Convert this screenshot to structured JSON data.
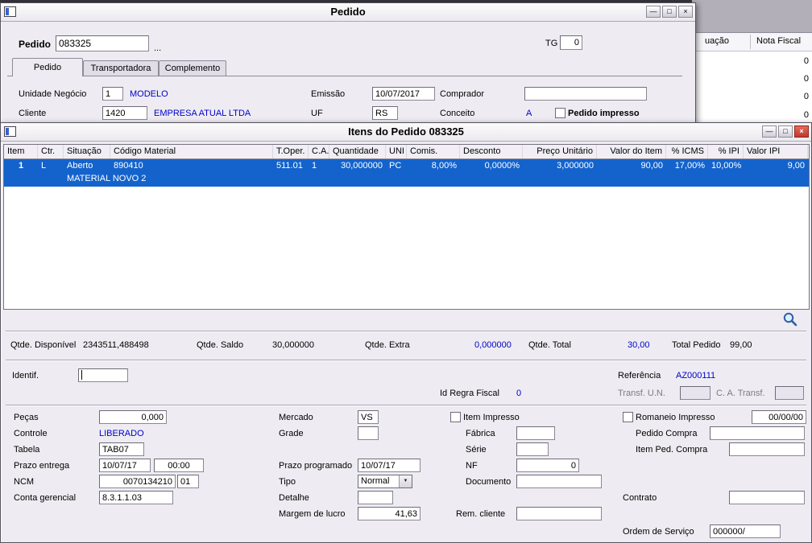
{
  "icons": {
    "minimize": "—",
    "maximize": "□",
    "close": "×",
    "dropdown": "▼",
    "ellipsis": "..."
  },
  "pedido_window": {
    "title": "Pedido",
    "pedido_label": "Pedido",
    "pedido_value": "083325",
    "tg_label": "TG",
    "tg_value": "0",
    "tabs": [
      {
        "label": "Pedido"
      },
      {
        "label": "Transportadora"
      },
      {
        "label": "Complemento"
      }
    ],
    "form": {
      "unidade_negocio_label": "Unidade Negócio",
      "unidade_negocio_value": "1",
      "unidade_negocio_desc": "MODELO",
      "emissao_label": "Emissão",
      "emissao_value": "10/07/2017",
      "comprador_label": "Comprador",
      "comprador_value": "",
      "cliente_label": "Cliente",
      "cliente_value": "1420",
      "cliente_desc": "EMPRESA ATUAL LTDA",
      "uf_label": "UF",
      "uf_value": "RS",
      "conceito_label": "Conceito",
      "conceito_value": "A",
      "pedido_impresso_label": "Pedido impresso"
    }
  },
  "background_window": {
    "column_headers": [
      "uação",
      "Nota Fiscal"
    ],
    "cell_values": [
      "0",
      "0",
      "0",
      "0"
    ]
  },
  "itens_window": {
    "title": "Itens do Pedido 083325",
    "table": {
      "columns": [
        "Item",
        "Ctr.",
        "Situação",
        "Código Material",
        "T.Oper.",
        "C.A.",
        "Quantidade",
        "UNI",
        "Comis.",
        "Desconto",
        "Preço Unitário",
        "Valor do Item",
        "% ICMS",
        "% IPI",
        "Valor IPI"
      ],
      "selected_row": {
        "item": "1",
        "ctr": "L",
        "situacao": "Aberto",
        "codigo_material": "890410",
        "t_oper": "511.01",
        "c_a": "1",
        "quantidade": "30,000000",
        "uni": "PC",
        "comis": "8,00%",
        "desconto": "0,0000%",
        "preco_unitario": "3,000000",
        "valor_do_item": "90,00",
        "icms": "17,00%",
        "ipi": "10,00%",
        "valor_ipi": "9,00",
        "descricao": "MATERIAL NOVO 2"
      }
    },
    "totals": {
      "qtde_disponivel_label": "Qtde. Disponível",
      "qtde_disponivel_value": "2343511,488498",
      "qtde_saldo_label": "Qtde. Saldo",
      "qtde_saldo_value": "30,000000",
      "qtde_extra_label": "Qtde. Extra",
      "qtde_extra_value": "0,000000",
      "qtde_total_label": "Qtde. Total",
      "qtde_total_value": "30,00",
      "total_pedido_label": "Total Pedido",
      "total_pedido_value": "99,00"
    },
    "detail": {
      "identif_label": "Identif.",
      "identif_value": "",
      "referencia_label": "Referência",
      "referencia_value": "AZ000111",
      "id_regra_fiscal_label": "Id Regra Fiscal",
      "id_regra_fiscal_value": "0",
      "transf_un_label": "Transf. U.N.",
      "transf_un_value": "",
      "ca_transf_label": "C. A. Transf.",
      "ca_transf_value": "",
      "pecas_label": "Peças",
      "pecas_value": "0,000",
      "mercado_label": "Mercado",
      "mercado_value": "VS",
      "item_impresso_label": "Item Impresso",
      "romaneio_impresso_label": "Romaneio Impresso",
      "romaneio_data_value": "00/00/00",
      "controle_label": "Controle",
      "controle_value": "LIBERADO",
      "grade_label": "Grade",
      "grade_value": "",
      "fabrica_label": "Fábrica",
      "fabrica_value": "",
      "pedido_compra_label": "Pedido Compra",
      "pedido_compra_value": "",
      "tabela_label": "Tabela",
      "tabela_value": "TAB07",
      "serie_label": "Série",
      "serie_value": "",
      "item_ped_compra_label": "Item Ped. Compra",
      "item_ped_compra_value": "",
      "prazo_entrega_label": "Prazo entrega",
      "prazo_entrega_data": "10/07/17",
      "prazo_entrega_hora": "00:00",
      "prazo_programado_label": "Prazo programado",
      "prazo_programado_value": "10/07/17",
      "nf_label": "NF",
      "nf_value": "0",
      "ncm_label": "NCM",
      "ncm_value": "0070134210",
      "ncm_ex_value": "01",
      "tipo_label": "Tipo",
      "tipo_value": "Normal",
      "documento_label": "Documento",
      "documento_value": "",
      "conta_gerencial_label": "Conta gerencial",
      "conta_gerencial_value": "8.3.1.1.03",
      "detalhe_label": "Detalhe",
      "detalhe_value": "",
      "contrato_label": "Contrato",
      "contrato_value": "",
      "margem_lucro_label": "Margem de lucro",
      "margem_lucro_value": "41,63",
      "rem_cliente_label": "Rem. cliente",
      "rem_cliente_value": "",
      "ordem_servico_label": "Ordem de Serviço",
      "ordem_servico_value": "000000/"
    }
  }
}
